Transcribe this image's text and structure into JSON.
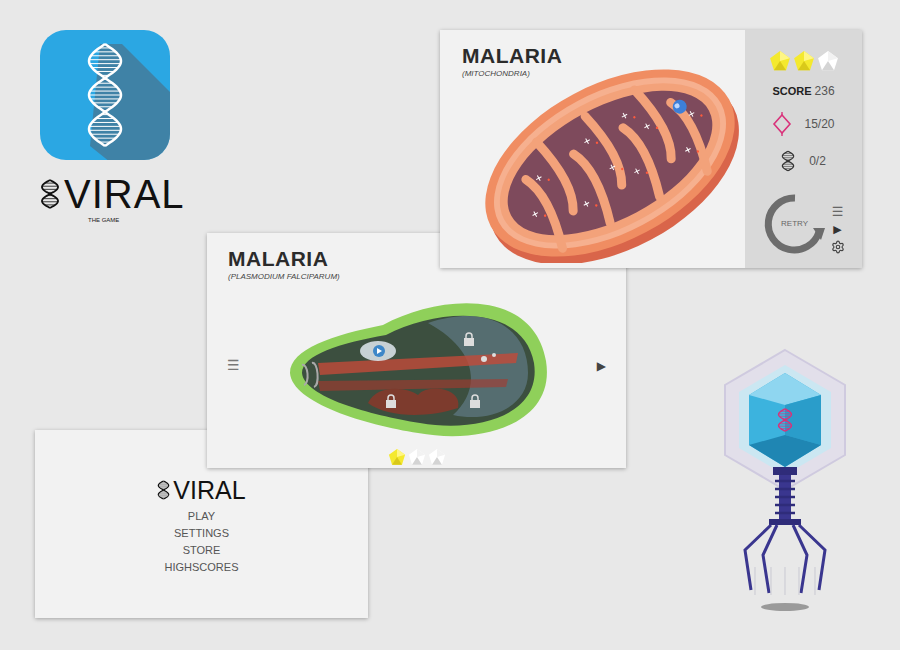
{
  "logo": {
    "title": "VIRAL",
    "tagline": "THE GAME"
  },
  "result_screen": {
    "title": "MALARIA",
    "subtitle": "(MITOCHONDRIA)",
    "stars": 2,
    "score_label": "SCORE",
    "score": "236",
    "collected": "15/20",
    "dna": "0/2",
    "retry": "RETRY",
    "menu": "☰",
    "next": "▶"
  },
  "level_screen": {
    "title": "MALARIA",
    "subtitle": "(PLASMODIUM FALCIPARUM)",
    "stars": 1,
    "menu": "☰",
    "next": "▶"
  },
  "main_menu": {
    "title": "VIRAL",
    "items": [
      "PLAY",
      "SETTINGS",
      "STORE",
      "HIGHSCORES"
    ]
  }
}
